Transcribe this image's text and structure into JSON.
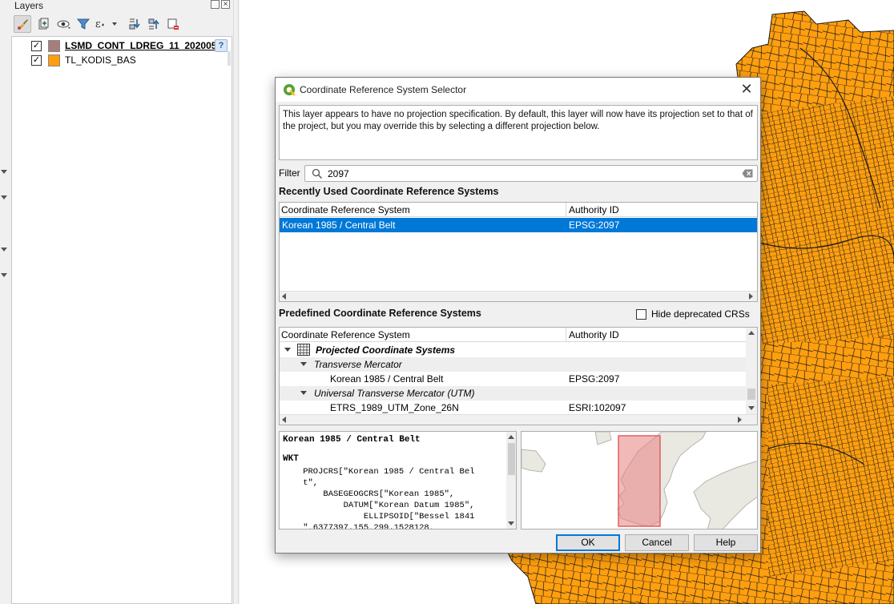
{
  "layers_panel": {
    "title": "Layers",
    "layers": [
      {
        "name": "LSMD_CONT_LDREG_11_202005",
        "checked": true,
        "color": "#a87d7d",
        "warning": "?"
      },
      {
        "name": "TL_KODIS_BAS",
        "checked": true,
        "color": "#ff9f0f"
      }
    ],
    "toolbar_icons": [
      "style-brush-icon",
      "add-group-icon",
      "visibility-eye-icon",
      "filter-icon",
      "expression-filter-icon",
      "expand-all-icon",
      "collapse-all-icon",
      "remove-layer-icon"
    ]
  },
  "dialog": {
    "title": "Coordinate Reference System Selector",
    "close": "✕",
    "info": "This layer appears to have no projection specification. By default, this layer will now have its projection set to that of the project, but you may override this by selecting a different projection below.",
    "filter_label": "Filter",
    "filter_value": "2097",
    "recent_title": "Recently Used Coordinate Reference Systems",
    "col_crs": "Coordinate Reference System",
    "col_auth": "Authority ID",
    "recent_rows": [
      {
        "crs": "Korean 1985 / Central Belt",
        "auth": "EPSG:2097"
      }
    ],
    "predefined_title": "Predefined Coordinate Reference Systems",
    "hide_deprecated": "Hide deprecated CRSs",
    "tree": {
      "group": "Projected Coordinate Systems",
      "sub1": "Transverse Mercator",
      "item1": {
        "crs": "Korean 1985 / Central Belt",
        "auth": "EPSG:2097"
      },
      "sub2": "Universal Transverse Mercator (UTM)",
      "item2": {
        "crs": "ETRS_1989_UTM_Zone_26N",
        "auth": "ESRI:102097"
      }
    },
    "wkt_name": "Korean 1985 / Central Belt",
    "wkt_label": "WKT",
    "wkt_text": "    PROJCRS[\"Korean 1985 / Central Bel\n    t\",\n        BASEGEOGCRS[\"Korean 1985\",\n            DATUM[\"Korean Datum 1985\",\n                ELLIPSOID[\"Bessel 1841\n    \",6377397.155,299.1528128,",
    "buttons": {
      "ok": "OK",
      "cancel": "Cancel",
      "help": "Help"
    }
  },
  "colors": {
    "map_fill": "#ff9f0f",
    "map_stroke": "#1a1a1a",
    "selection": "#0078d7",
    "extent": "#e88080"
  }
}
